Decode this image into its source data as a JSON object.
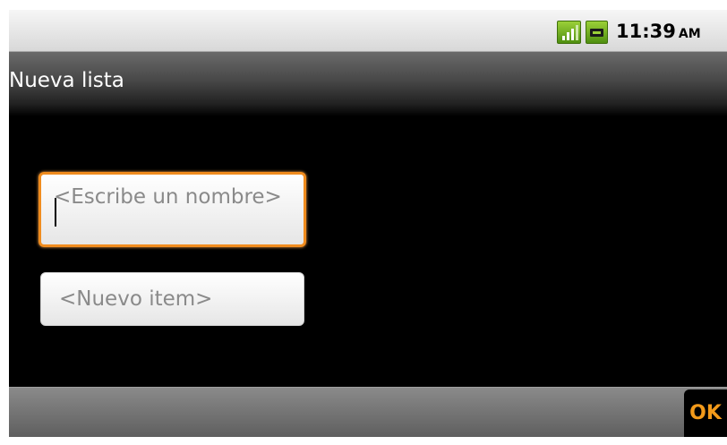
{
  "status_bar": {
    "time": "11:39",
    "ampm": "AM",
    "signal_icon": "signal-strength-icon",
    "battery_icon": "battery-charging-icon",
    "accent_color": "#7ab82a"
  },
  "title_bar": {
    "title": "Nueva lista"
  },
  "form": {
    "name_field": {
      "placeholder": "<Escribe un nombre>",
      "value": "",
      "focused": true,
      "focus_color": "#f08c1e"
    },
    "item_field": {
      "placeholder": "<Nuevo item>",
      "value": ""
    }
  },
  "bottom_bar": {
    "ok_label": "OK",
    "ok_color": "#f39a1a"
  }
}
